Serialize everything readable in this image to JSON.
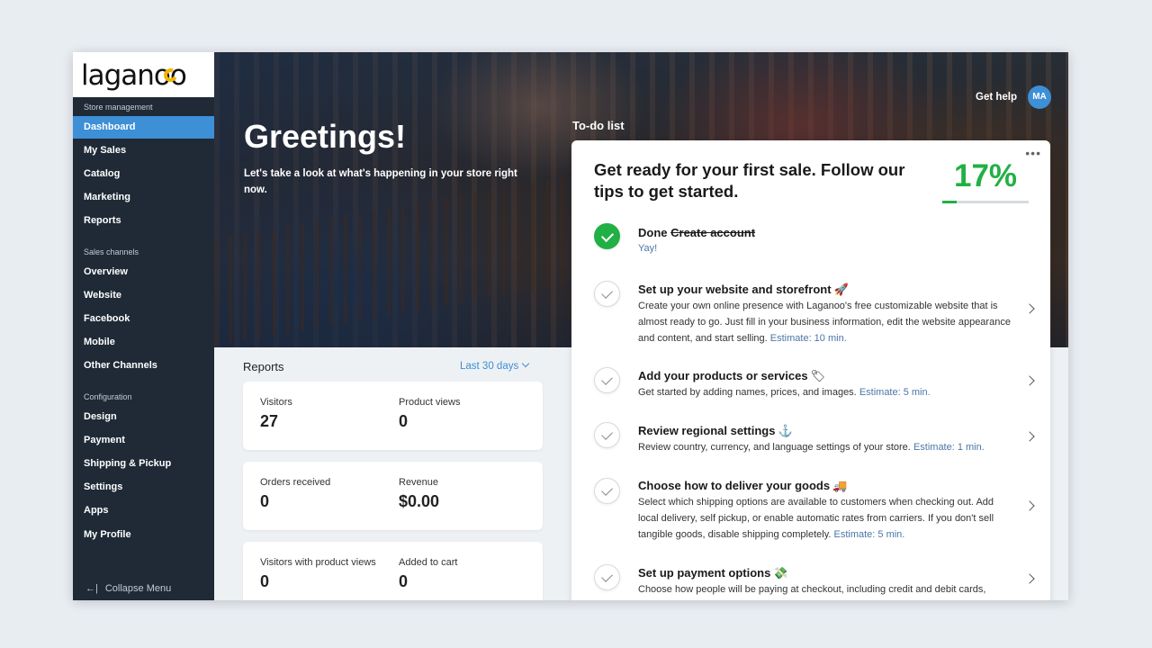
{
  "brand": {
    "logo_text": "laganoo"
  },
  "sidebar": {
    "sections": [
      {
        "label": "Store management"
      },
      {
        "label": "Sales channels"
      },
      {
        "label": "Configuration"
      }
    ],
    "items": [
      {
        "label": "Dashboard",
        "active": true
      },
      {
        "label": "My Sales"
      },
      {
        "label": "Catalog"
      },
      {
        "label": "Marketing"
      },
      {
        "label": "Reports"
      },
      {
        "label": "Overview"
      },
      {
        "label": "Website"
      },
      {
        "label": "Facebook"
      },
      {
        "label": "Mobile"
      },
      {
        "label": "Other Channels"
      },
      {
        "label": "Design"
      },
      {
        "label": "Payment"
      },
      {
        "label": "Shipping & Pickup"
      },
      {
        "label": "Settings"
      },
      {
        "label": "Apps"
      },
      {
        "label": "My Profile"
      }
    ],
    "collapse_label": "Collapse Menu",
    "collapse_icon": "arrow-left-bar-icon"
  },
  "hero": {
    "greeting": "Greetings!",
    "subtext": "Let's take a look at what's happening in your store right now.",
    "todo_label": "To-do list",
    "get_help": "Get help",
    "avatar_initials": "MA"
  },
  "reports": {
    "title": "Reports",
    "range": "Last 30 days",
    "cards": [
      {
        "left_label": "Visitors",
        "left_value": "27",
        "right_label": "Product views",
        "right_value": "0"
      },
      {
        "left_label": "Orders received",
        "left_value": "0",
        "right_label": "Revenue",
        "right_value": "$0.00"
      },
      {
        "left_label": "Visitors with product views",
        "left_value": "0",
        "right_label": "Added to cart",
        "right_value": "0"
      }
    ]
  },
  "todo": {
    "heading": "Get ready for your first sale. Follow our tips to get started.",
    "progress_text": "17%",
    "progress_fraction": 0.17,
    "more_icon": "ellipsis-icon",
    "tasks": [
      {
        "done_word": "Done",
        "title": "Create account",
        "status": "Yay!",
        "done": true
      },
      {
        "title": "Set up your website and storefront",
        "emoji": "🚀",
        "desc": "Create your own online presence with Laganoo's free customizable website that is almost ready to go. Just fill in your business information, edit the website appearance and content, and start selling.",
        "estimate": "Estimate: 10 min."
      },
      {
        "title": "Add your products or services",
        "emoji": "🏷",
        "desc": "Get started by adding names, prices, and images.",
        "estimate": "Estimate: 5 min."
      },
      {
        "title": "Review regional settings",
        "emoji": "⚓",
        "desc": "Review country, currency, and language settings of your store.",
        "estimate": "Estimate: 1 min."
      },
      {
        "title": "Choose how to deliver your goods",
        "emoji": "🚚",
        "desc": "Select which shipping options are available to customers when checking out. Add local delivery, self pickup, or enable automatic rates from carriers. If you don't sell tangible goods, disable shipping completely.",
        "estimate": "Estimate: 5 min."
      },
      {
        "title": "Set up payment options",
        "emoji": "💸",
        "desc": "Choose how people will be paying at checkout, including credit and debit cards,"
      }
    ]
  },
  "colors": {
    "accent": "#3d8fd6",
    "success": "#21b045",
    "sidebar_bg": "#1f2a36"
  }
}
